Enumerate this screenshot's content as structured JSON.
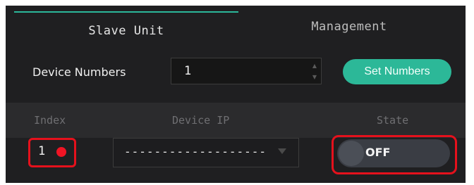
{
  "tabs": [
    {
      "label": "Slave Unit",
      "active": true
    },
    {
      "label": "Management",
      "active": false
    }
  ],
  "device_numbers": {
    "label": "Device Numbers",
    "value": "1",
    "button_label": "Set Numbers"
  },
  "table": {
    "headers": [
      "Index",
      "Device IP",
      "State"
    ],
    "rows": [
      {
        "index": "1",
        "status_dot_color": "#f01424",
        "device_ip": "-------------------",
        "state": "OFF"
      }
    ]
  },
  "colors": {
    "accent": "#2cb898",
    "highlight": "#e5111c",
    "background": "#1f1f21"
  }
}
